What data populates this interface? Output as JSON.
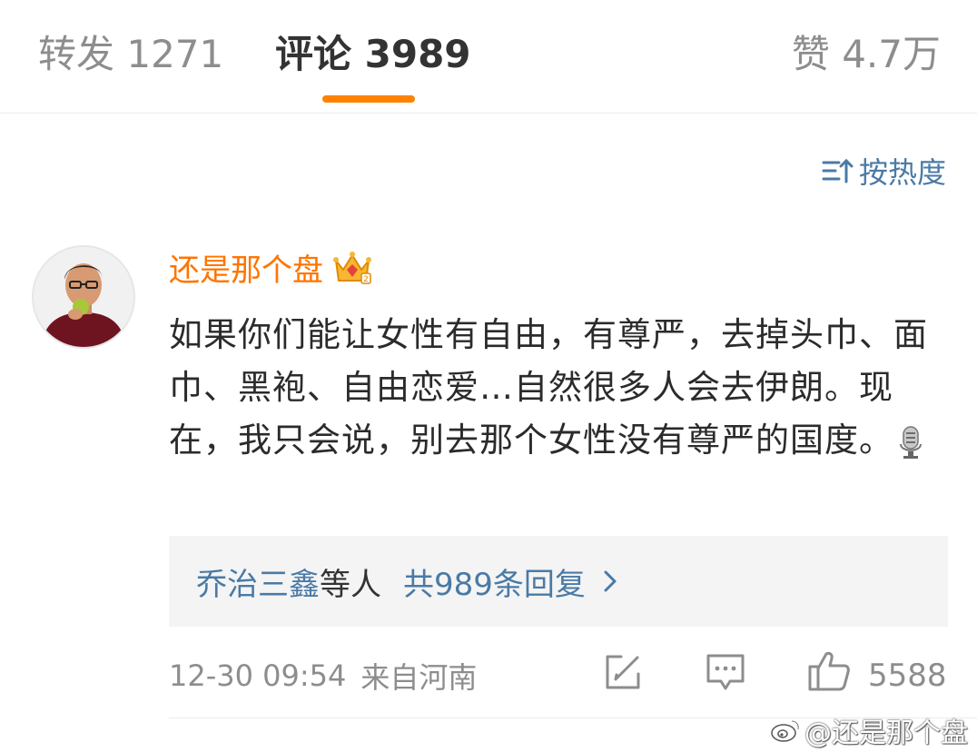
{
  "tabs": {
    "repost": "转发 1271",
    "comments": "评论 3989",
    "likes": "赞 4.7万",
    "active_color": "#ff8200"
  },
  "sort": {
    "label": "按热度",
    "icon": "sort-icon"
  },
  "comment": {
    "username": "还是那个盘",
    "badge_icon": "crown-badge-icon",
    "text": "如果你们能让女性有自由，有尊严，去掉头巾、面巾、黑袍、自由恋爱…自然很多人会去伊朗。现在，我只会说，别去那个女性没有尊严的国度。",
    "emoji_icon": "microphone-icon",
    "replies": {
      "names": "乔治三鑫",
      "suffix": "等人",
      "count_label": "共989条回复"
    },
    "time": "12-30 09:54",
    "location": "来自河南",
    "likes": "5588"
  },
  "watermark": "@还是那个盘",
  "colors": {
    "username": "#ff7500",
    "link": "#4a7aa6",
    "meta": "#8d8d8d"
  }
}
